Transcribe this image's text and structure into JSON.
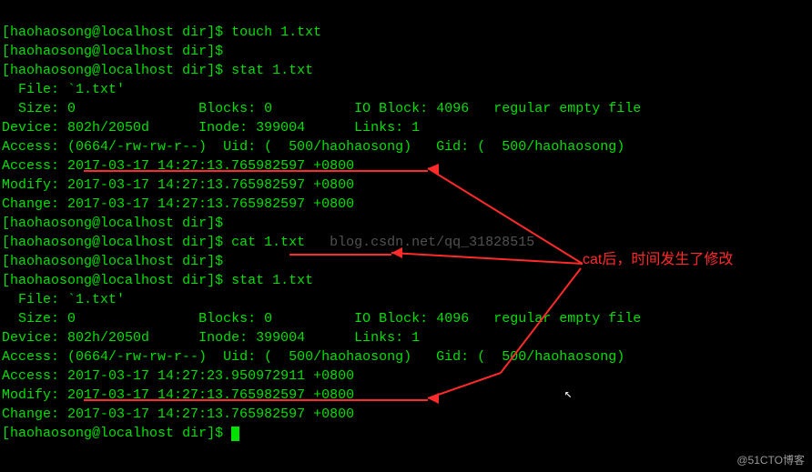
{
  "prompt": {
    "user": "haohaosong",
    "host": "localhost",
    "dir": "dir"
  },
  "cmds": {
    "touch": "touch 1.txt",
    "stat": "stat 1.txt",
    "cat": "cat 1.txt"
  },
  "stat1": {
    "file_label": "File:",
    "file_name": "`1.txt'",
    "size_label": "Size:",
    "size": "0",
    "blocks_label": "Blocks:",
    "blocks": "0",
    "ioblock_label": "IO Block:",
    "ioblock": "4096",
    "type": "regular empty file",
    "device_label": "Device:",
    "device": "802h/2050d",
    "inode_label": "Inode:",
    "inode": "399004",
    "links_label": "Links:",
    "links": "1",
    "perm_label": "Access:",
    "perm": "(0664/-rw-rw-r--)",
    "uid_label": "Uid:",
    "uid": "(  500/haohaosong)",
    "gid_label": "Gid:",
    "gid": "(  500/haohaosong)",
    "access_label": "Access:",
    "access_time": "2017-03-17 14:27:13.765982597 +0800",
    "modify_label": "Modify:",
    "modify_time": "2017-03-17 14:27:13.765982597 +0800",
    "change_label": "Change:",
    "change_time": "2017-03-17 14:27:13.765982597 +0800"
  },
  "stat2": {
    "file_label": "File:",
    "file_name": "`1.txt'",
    "size_label": "Size:",
    "size": "0",
    "blocks_label": "Blocks:",
    "blocks": "0",
    "ioblock_label": "IO Block:",
    "ioblock": "4096",
    "type": "regular empty file",
    "device_label": "Device:",
    "device": "802h/2050d",
    "inode_label": "Inode:",
    "inode": "399004",
    "links_label": "Links:",
    "links": "1",
    "perm_label": "Access:",
    "perm": "(0664/-rw-rw-r--)",
    "uid_label": "Uid:",
    "uid": "(  500/haohaosong)",
    "gid_label": "Gid:",
    "gid": "(  500/haohaosong)",
    "access_label": "Access:",
    "access_time": "2017-03-17 14:27:23.950972911 +0800",
    "modify_label": "Modify:",
    "modify_time": "2017-03-17 14:27:13.765982597 +0800",
    "change_label": "Change:",
    "change_time": "2017-03-17 14:27:13.765982597 +0800"
  },
  "watermark_center": "blog.csdn.net/qq_31828515",
  "annotation_text": "cat后，时间发生了修改",
  "footer": "@51CTO博客",
  "colors": {
    "fg": "#00e000",
    "bg": "#000000",
    "annotation": "#ff2a2a"
  }
}
